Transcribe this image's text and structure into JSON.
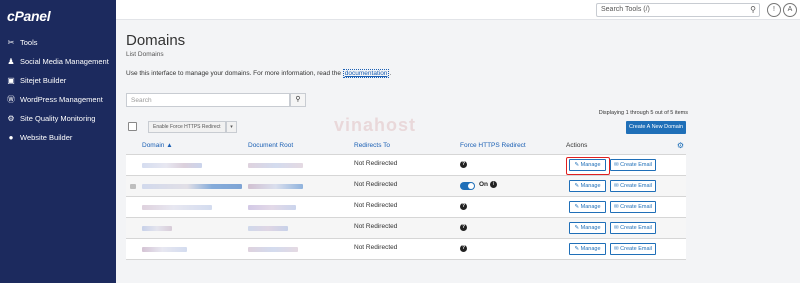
{
  "brand": {
    "logo": "cPanel"
  },
  "sidebar": {
    "items": [
      {
        "label": "Tools",
        "icon": "tools-icon",
        "glyph": "✂"
      },
      {
        "label": "Social Media Management",
        "icon": "social-icon",
        "glyph": "♟"
      },
      {
        "label": "Sitejet Builder",
        "icon": "sitejet-icon",
        "glyph": "▣"
      },
      {
        "label": "WordPress Management",
        "icon": "wordpress-icon",
        "glyph": "Ⓦ"
      },
      {
        "label": "Site Quality Monitoring",
        "icon": "monitor-icon",
        "glyph": "⚙"
      },
      {
        "label": "Website Builder",
        "icon": "builder-icon",
        "glyph": "●"
      }
    ]
  },
  "topbar": {
    "search_placeholder": "Search Tools (/)",
    "bell": "!",
    "user": "A"
  },
  "page": {
    "title": "Domains",
    "subtitle": "List Domains",
    "intro": "Use this interface to manage your domains. For more information, read the",
    "intro_link": "documentation",
    "intro_end": ".",
    "search_placeholder": "Search",
    "displaying": "Displaying 1 through 5 out of 5 items",
    "create_button": "Create A New Domain",
    "https_button": "Enable Force HTTPS Redirect",
    "watermark": "vinahost"
  },
  "table": {
    "headers": {
      "domain": "Domain ▲",
      "root": "Document Root",
      "redirects": "Redirects To",
      "force": "Force HTTPS Redirect",
      "actions": "Actions"
    },
    "rows": [
      {
        "redirects": "Not Redirected",
        "force": "?"
      },
      {
        "redirects": "Not Redirected",
        "force": "On",
        "toggle": true
      },
      {
        "redirects": "Not Redirected",
        "force": "?"
      },
      {
        "redirects": "Not Redirected",
        "force": "?"
      },
      {
        "redirects": "Not Redirected",
        "force": "?"
      }
    ],
    "manage_label": "✎ Manage",
    "email_label": "✉ Create Email"
  }
}
